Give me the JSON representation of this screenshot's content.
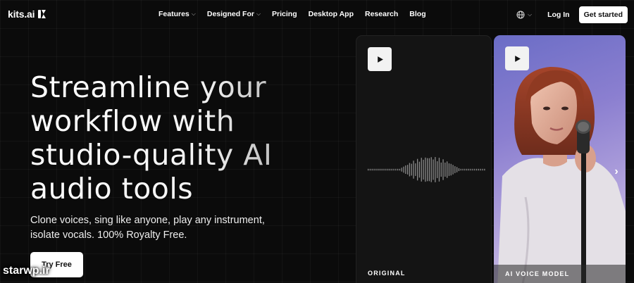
{
  "brand": {
    "name": "kits.ai"
  },
  "nav": {
    "links": [
      {
        "label": "Features",
        "dropdown": true
      },
      {
        "label": "Designed For",
        "dropdown": true
      },
      {
        "label": "Pricing",
        "dropdown": false
      },
      {
        "label": "Desktop App",
        "dropdown": false
      },
      {
        "label": "Research",
        "dropdown": false
      },
      {
        "label": "Blog",
        "dropdown": false
      }
    ],
    "language_icon": "globe-icon",
    "login_label": "Log In",
    "cta_label": "Get started"
  },
  "hero": {
    "title_lines": [
      "Streamline your",
      "workflow with",
      "studio-quality AI",
      "audio tools"
    ],
    "subtitle_lines": [
      "Clone voices, sing like anyone, play any instrument,",
      "isolate vocals. 100% Royalty Free."
    ],
    "cta_label": "Try Free"
  },
  "cards": [
    {
      "label": "ORIGINAL",
      "icon": "play-icon"
    },
    {
      "label": "AI VOICE MODEL",
      "icon": "play-icon"
    }
  ],
  "carousel": {
    "next_icon": "chevron-right-icon"
  },
  "watermark": "starwp.ir",
  "colors": {
    "background": "#0b0b0b",
    "button": "#ffffff",
    "text": "#ffffff"
  }
}
